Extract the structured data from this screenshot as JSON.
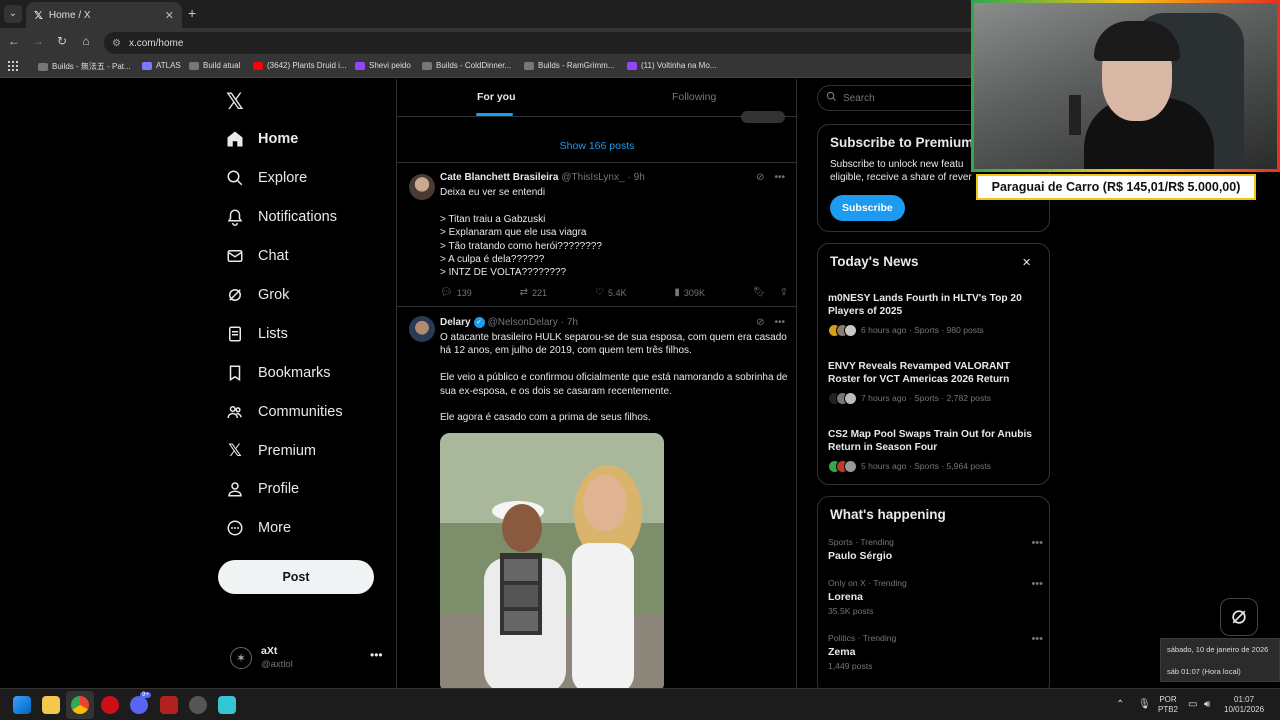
{
  "browser": {
    "tab_title": "Home / X",
    "url": "x.com/home",
    "bookmarks": [
      {
        "label": "Builds - 無法五 - Pat...",
        "color": "#888"
      },
      {
        "label": "ATLAS",
        "color": "#7a7aff"
      },
      {
        "label": "Build atual",
        "color": "#888"
      },
      {
        "label": "(3642) Plants Druid i...",
        "color": "#ff0000"
      },
      {
        "label": "Shevi peido",
        "color": "#9146ff"
      },
      {
        "label": "Builds - ColdDinner...",
        "color": "#888"
      },
      {
        "label": "Builds - RamGrimm...",
        "color": "#888"
      },
      {
        "label": "(11) Voltinha na Mo...",
        "color": "#9146ff"
      }
    ]
  },
  "nav": {
    "items": [
      {
        "label": "Home",
        "icon": "home-icon"
      },
      {
        "label": "Explore",
        "icon": "search-icon"
      },
      {
        "label": "Notifications",
        "icon": "bell-icon"
      },
      {
        "label": "Chat",
        "icon": "mail-icon"
      },
      {
        "label": "Grok",
        "icon": "grok-icon"
      },
      {
        "label": "Lists",
        "icon": "lists-icon"
      },
      {
        "label": "Bookmarks",
        "icon": "bookmark-icon"
      },
      {
        "label": "Communities",
        "icon": "communities-icon"
      },
      {
        "label": "Premium",
        "icon": "x-icon"
      },
      {
        "label": "Profile",
        "icon": "person-icon"
      },
      {
        "label": "More",
        "icon": "more-circle-icon"
      }
    ],
    "post_label": "Post",
    "account": {
      "name": "aXt",
      "handle": "@axtlol"
    }
  },
  "feed": {
    "tabs": [
      "For you",
      "Following"
    ],
    "show_posts": "Show 166 posts",
    "tweets": [
      {
        "name": "Cate Blanchett Brasileira",
        "handle": "@ThisIsLynx_",
        "time": "· 9h",
        "lines": [
          "Deixa eu ver se entendi",
          "",
          "> Titan traiu a Gabzuski",
          "> Explanaram que ele usa viagra",
          "> Tão tratando como herói????????",
          "> A culpa é dela??????",
          "> INTZ DE VOLTA????????"
        ],
        "replies": "139",
        "reposts": "221",
        "likes": "5.4K",
        "views": "309K"
      },
      {
        "name": "Delary",
        "handle": "@NelsonDelary",
        "time": "· 7h",
        "lines": [
          "O atacante brasileiro HULK separou-se de sua esposa, com quem era casado há 12 anos, em julho de 2019, com quem tem três filhos.",
          "Ele veio a público e confirmou oficialmente que está namorando a sobrinha de sua ex-esposa, e os dois se casaram recentemente.",
          "Ele agora é casado com a prima de seus filhos."
        ]
      }
    ]
  },
  "sidebar": {
    "search_placeholder": "Search",
    "premium": {
      "title": "Subscribe to Premium",
      "text_line1": "Subscribe to unlock new featu",
      "text_line2": "eligible, receive a share of rever",
      "button": "Subscribe"
    },
    "news": {
      "title": "Today's News",
      "items": [
        {
          "title": "m0NESY Lands Fourth in HLTV's Top 20 Players of 2025",
          "meta": "6 hours ago · Sports · 980 posts"
        },
        {
          "title": "ENVY Reveals Revamped VALORANT Roster for VCT Americas 2026 Return",
          "meta": "7 hours ago · Sports · 2,782 posts"
        },
        {
          "title": "CS2 Map Pool Swaps Train Out for Anubis Return in Season Four",
          "meta": "5 hours ago · Sports · 5,964 posts"
        }
      ]
    },
    "happening": {
      "title": "What's happening",
      "trends": [
        {
          "category": "Sports · Trending",
          "name": "Paulo Sérgio",
          "count": ""
        },
        {
          "category": "Only on X · Trending",
          "name": "Lorena",
          "count": "35.5K posts"
        },
        {
          "category": "Politics · Trending",
          "name": "Zema",
          "count": "1,449 posts"
        }
      ]
    }
  },
  "overlay": {
    "donation": "Paraguai de Carro (R$ 145,01/R$ 5.000,00)"
  },
  "tooltip": {
    "line1": "sábado, 10 de janeiro de 2026",
    "line2": "sáb 01:07 (Hora local)"
  },
  "taskbar": {
    "lang": "POR",
    "layout": "PTB2",
    "time": "01:07",
    "date": "10/01/2026",
    "badge": "9+"
  }
}
